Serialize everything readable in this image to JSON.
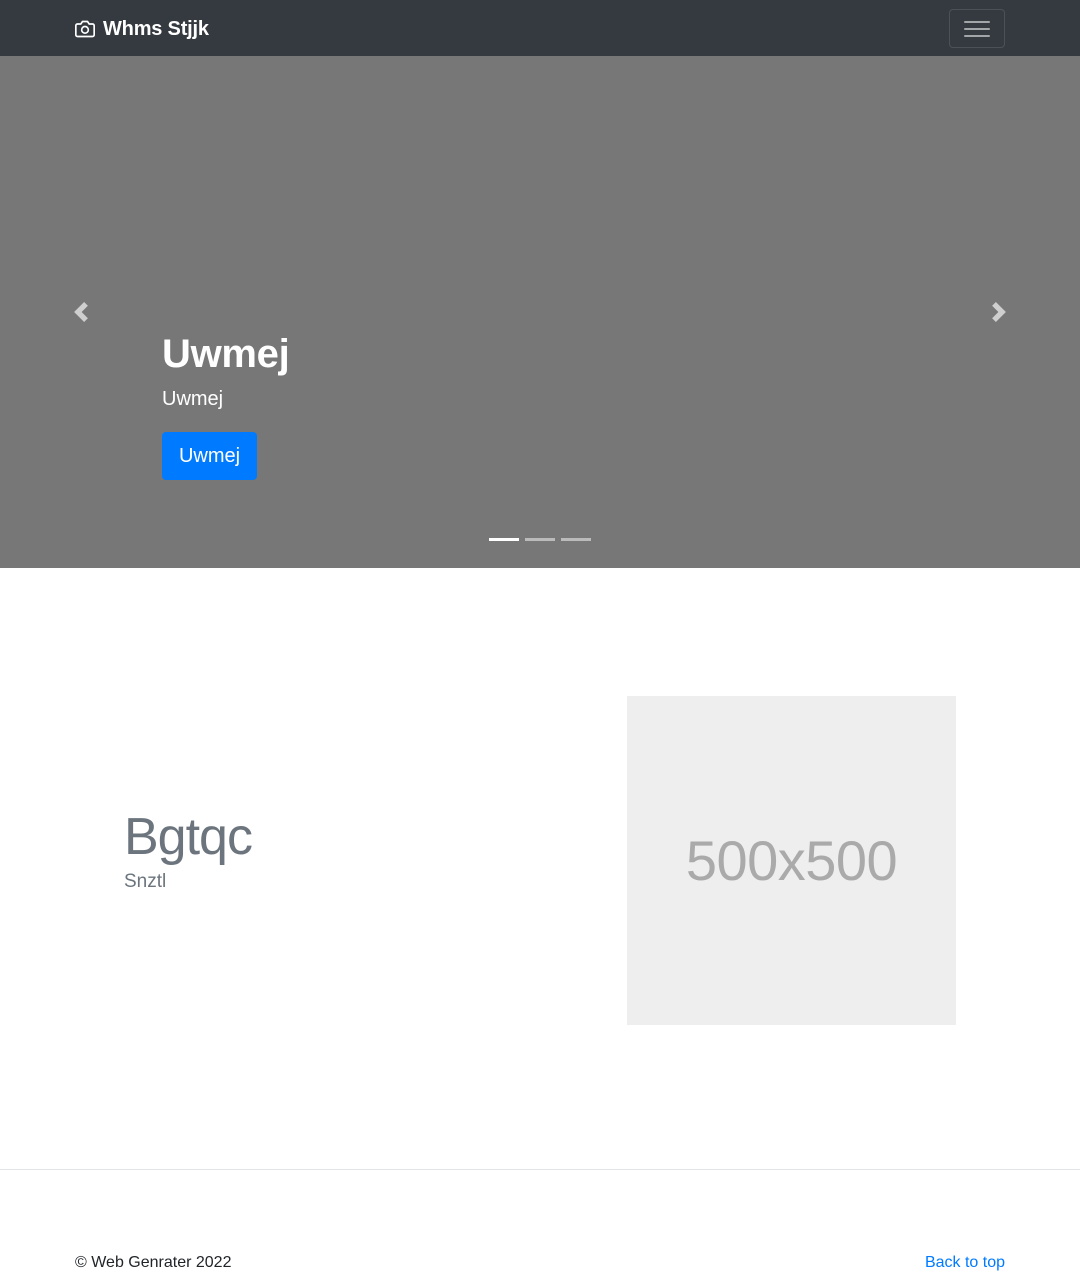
{
  "navbar": {
    "brand": "Whms Stjjk",
    "brand_icon": "camera-icon",
    "toggler_icon": "hamburger-menu-icon",
    "background_color": "#343a40"
  },
  "carousel": {
    "background_color": "#777777",
    "slide": {
      "title": "Uwmej",
      "text": "Uwmej",
      "button_label": "Uwmej"
    },
    "prev_icon": "chevron-left-icon",
    "next_icon": "chevron-right-icon",
    "indicator_count": 3,
    "active_indicator": 1
  },
  "featurette": {
    "heading": "Bgtqc",
    "lead": "Snztl",
    "image_placeholder": "500x500"
  },
  "footer": {
    "copyright": "© Web Genrater 2022",
    "back_to_top": "Back to top"
  },
  "colors": {
    "primary": "#007bff",
    "muted_text": "#6c757d",
    "placeholder_bg": "#eeeeee"
  }
}
